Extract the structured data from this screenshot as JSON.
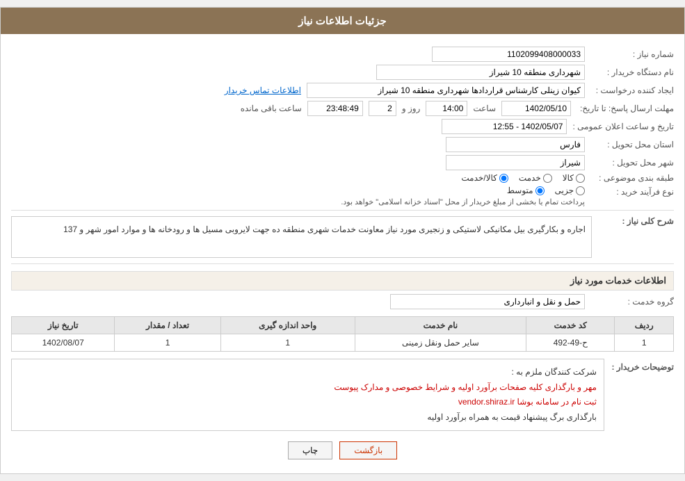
{
  "header": {
    "title": "جزئیات اطلاعات نیاز"
  },
  "fields": {
    "need_number_label": "شماره نیاز :",
    "need_number_value": "1102099408000033",
    "buyer_org_label": "نام دستگاه خریدار :",
    "buyer_org_value": "شهرداری منطقه 10 شیراز",
    "creator_label": "ایجاد کننده درخواست :",
    "creator_value": "کیوان زینلی کارشناس قراردادها شهرداری منطقه 10 شیراز",
    "contact_link": "اطلاعات تماس خریدار",
    "deadline_label": "مهلت ارسال پاسخ: تا تاریخ:",
    "deadline_date": "1402/05/10",
    "deadline_time_label": "ساعت",
    "deadline_time": "14:00",
    "deadline_day_label": "روز و",
    "deadline_days": "2",
    "deadline_remaining_label": "ساعت باقی مانده",
    "deadline_remaining": "23:48:49",
    "announce_label": "تاریخ و ساعت اعلان عمومی :",
    "announce_value": "1402/05/07 - 12:55",
    "province_label": "استان محل تحویل :",
    "province_value": "فارس",
    "city_label": "شهر محل تحویل :",
    "city_value": "شیراز",
    "category_label": "طبقه بندی موضوعی :",
    "category_options": [
      "کالا",
      "خدمت",
      "کالا/خدمت"
    ],
    "category_selected": "کالا",
    "process_label": "نوع فرآیند خرید :",
    "process_options": [
      "جزیی",
      "متوسط"
    ],
    "process_selected": "متوسط",
    "process_note": "پرداخت تمام یا بخشی از مبلغ خریدار از محل \"اسناد خزانه اسلامی\" خواهد بود."
  },
  "description_section": {
    "title": "شرح کلی نیاز :",
    "content": "اجاره و بکارگیری بیل مکانیکی لاستیکی و زنجیری مورد نیاز معاونت خدمات شهری منطقه ده جهت لایروبی مسیل ها و رودخانه ها و موارد امور شهر  و 137"
  },
  "services_section": {
    "title": "اطلاعات خدمات مورد نیاز",
    "group_label": "گروه خدمت :",
    "group_value": "حمل و نقل و انبارداری",
    "table": {
      "headers": [
        "ردیف",
        "کد خدمت",
        "نام خدمت",
        "واحد اندازه گیری",
        "تعداد / مقدار",
        "تاریخ نیاز"
      ],
      "rows": [
        {
          "row": "1",
          "code": "ح-49-492",
          "name": "سایر حمل ونقل زمینی",
          "unit": "1",
          "quantity": "1",
          "date": "1402/08/07"
        }
      ]
    }
  },
  "buyer_notes_section": {
    "label": "توضیحات خریدار :",
    "lines": [
      "شرکت کنندگان ملزم به :",
      "مهر و بارگذاری کلیه صفحات برآورد اولیه و شرایط خصوصی و مدارک پیوست",
      "ثبت نام در سامانه بوشا vendor.shiraz.ir",
      "بارگذاری برگ پیشنهاد قیمت به همراه برآورد اولیه"
    ],
    "red_lines": [
      1,
      2
    ]
  },
  "buttons": {
    "print": "چاپ",
    "back": "بازگشت"
  }
}
